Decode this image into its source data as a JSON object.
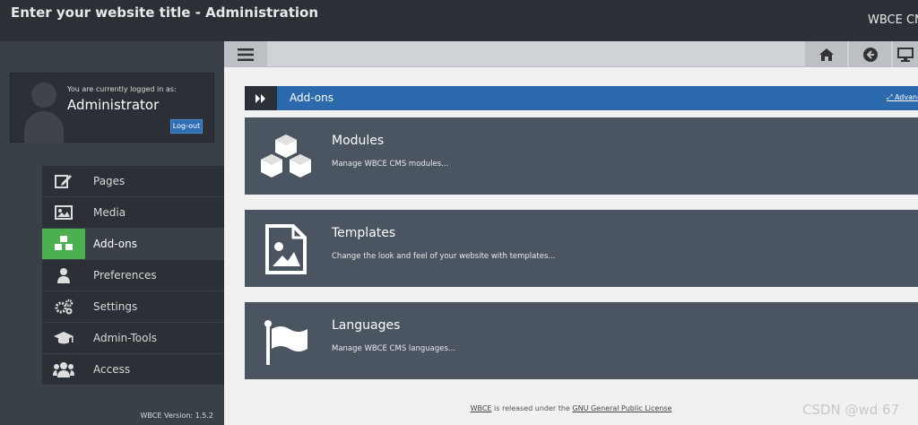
{
  "header": {
    "site_title": "Enter your website title - Administration",
    "brand": "WBCE CMS"
  },
  "user": {
    "logged_in_text": "You are currently logged in as:",
    "name": "Administrator",
    "logout_label": "Log-out"
  },
  "sidebar": {
    "items": [
      {
        "label": "Pages",
        "icon": "edit-icon"
      },
      {
        "label": "Media",
        "icon": "image-icon"
      },
      {
        "label": "Add-ons",
        "icon": "cubes-icon",
        "active": true
      },
      {
        "label": "Preferences",
        "icon": "user-icon"
      },
      {
        "label": "Settings",
        "icon": "gears-icon"
      },
      {
        "label": "Admin-Tools",
        "icon": "graduation-cap-icon"
      },
      {
        "label": "Access",
        "icon": "users-icon"
      }
    ],
    "version_label": "WBCE Version: 1.5.2"
  },
  "toolbar": {
    "buttons": [
      "menu-icon",
      "home-icon",
      "back-icon",
      "desktop-icon"
    ]
  },
  "section": {
    "title": "Add-ons",
    "advanced_label": "Advanced"
  },
  "cards": [
    {
      "title": "Modules",
      "description": "Manage WBCE CMS modules...",
      "icon": "cubes-icon"
    },
    {
      "title": "Templates",
      "description": "Change the look and feel of your website with templates...",
      "icon": "file-image-icon"
    },
    {
      "title": "Languages",
      "description": "Manage WBCE CMS languages...",
      "icon": "flag-icon"
    }
  ],
  "footer": {
    "wbce_link": "WBCE",
    "text_middle": "is released under the",
    "license_link": "GNU General Public License"
  },
  "watermark": "CSDN @wd 67",
  "colors": {
    "header_bg": "#2b2f36",
    "sidebar_bg": "#3a4048",
    "active_green": "#4caf50",
    "section_blue": "#2d69ad",
    "card_bg": "#4b5461"
  }
}
